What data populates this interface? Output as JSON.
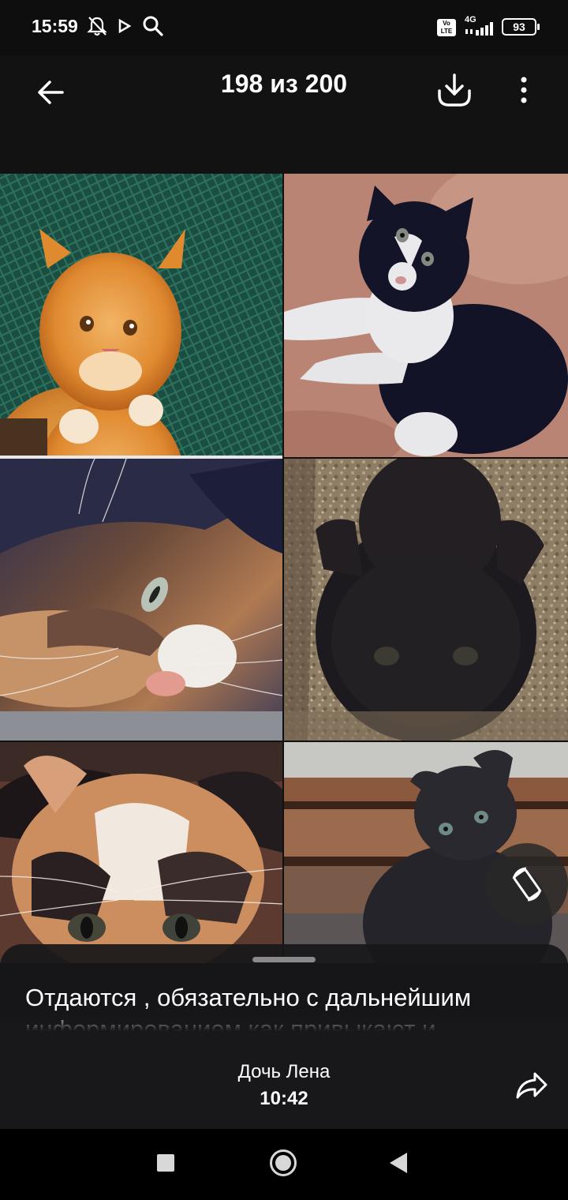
{
  "status_bar": {
    "time": "15:59",
    "icons": [
      "alarm-off-icon",
      "play-icon",
      "search-icon",
      "volte-icon",
      "signal-icon"
    ],
    "lte_label": "Vo LTE",
    "network": "4G",
    "battery": "93"
  },
  "header": {
    "counter": "198 из 200",
    "back_icon": "arrow-left-icon",
    "download_icon": "download-icon",
    "menu_icon": "more-vertical-icon"
  },
  "photo": {
    "rotate_icon": "screen-rotation-icon"
  },
  "caption": {
    "text": "Отдаются , обязательно с дальнейшим информированием как привыкают и"
  },
  "footer": {
    "sender": "Дочь Лена",
    "time": "10:42",
    "share_icon": "share-icon"
  },
  "nav": {
    "recents_icon": "square-icon",
    "home_icon": "circle-icon",
    "back_icon": "triangle-back-icon"
  }
}
